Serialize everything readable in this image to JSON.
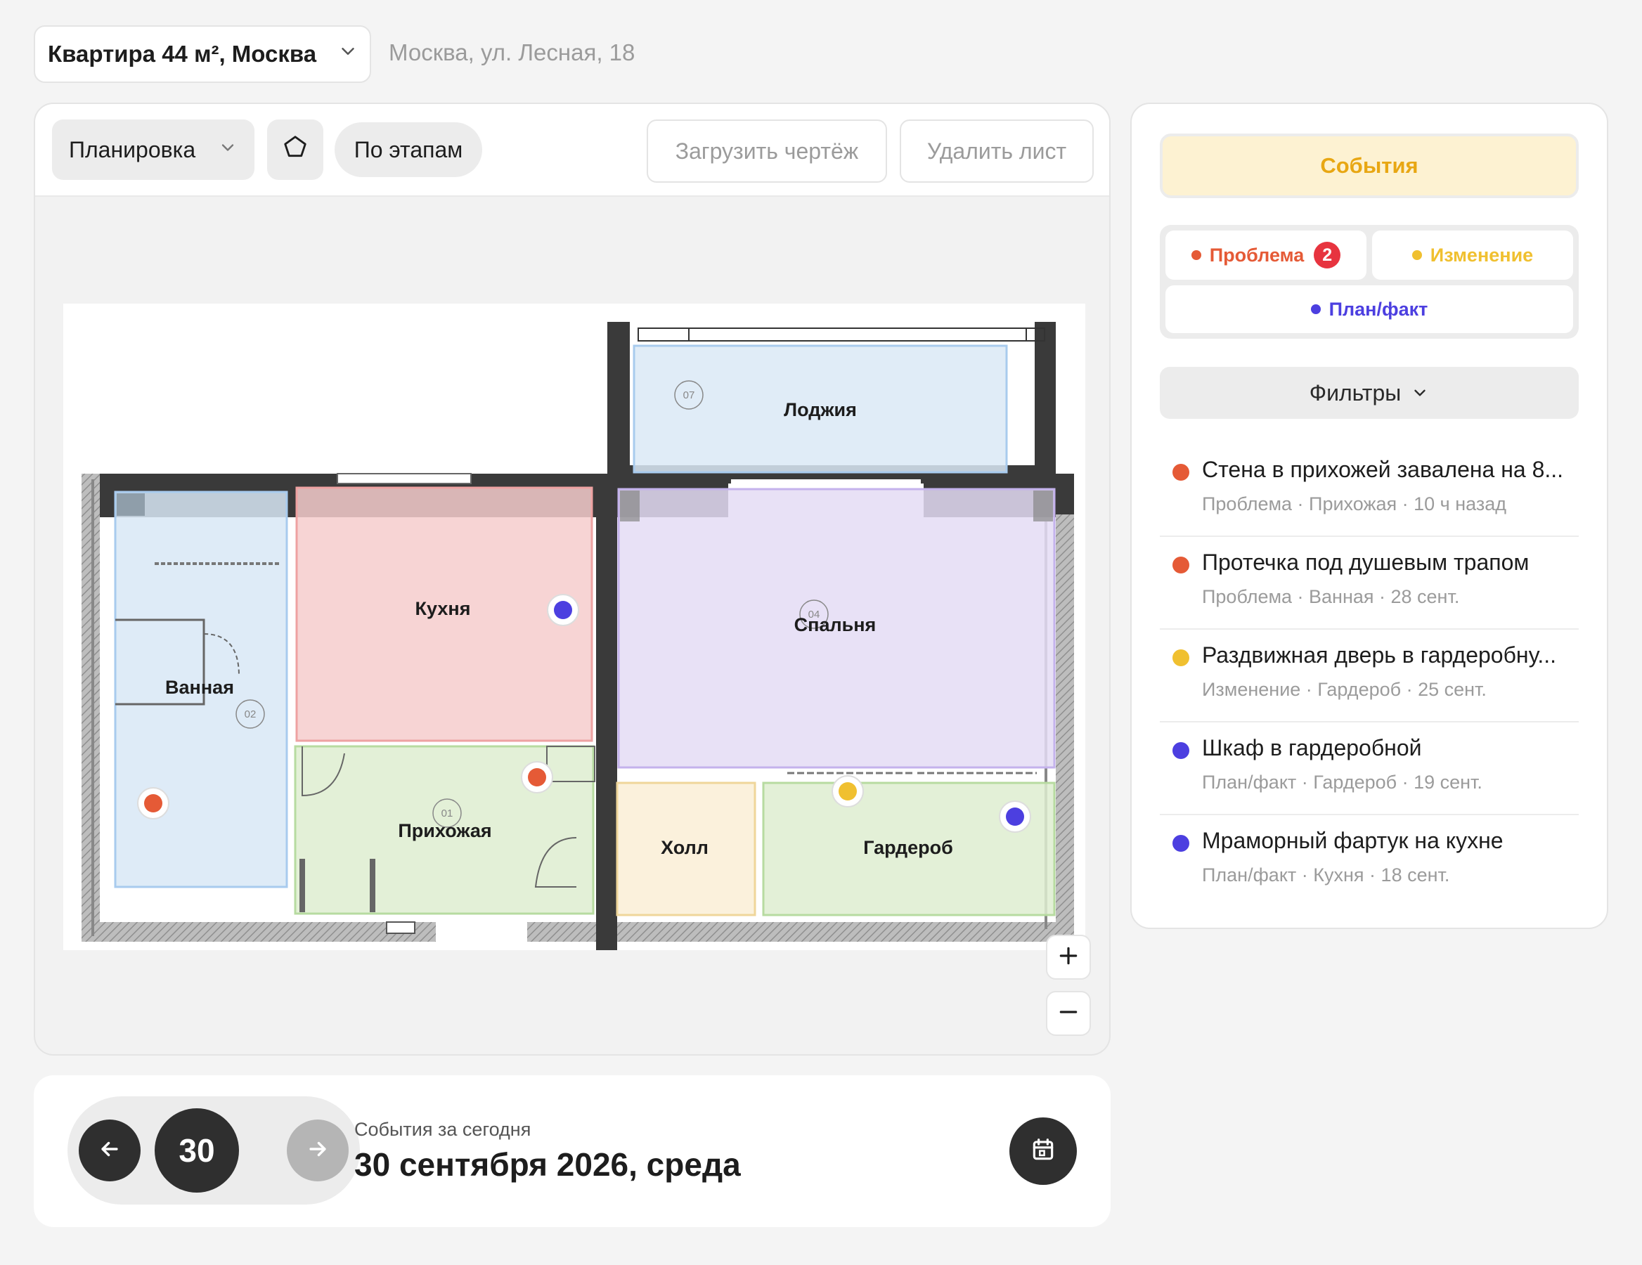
{
  "project": {
    "name": "Квартира 44 м², Москва",
    "address": "Москва, ул. Лесная, 18"
  },
  "toolbar": {
    "layout_label": "Планировка",
    "stages_label": "По этапам",
    "upload_label": "Загрузить чертёж",
    "delete_label": "Удалить лист"
  },
  "rooms": {
    "loggia": {
      "name": "Лоджия",
      "num": "07"
    },
    "kitchen": {
      "name": "Кухня"
    },
    "bedroom": {
      "name": "Спальня",
      "num": "04"
    },
    "bathroom": {
      "name": "Ванная",
      "num": "02"
    },
    "hallway": {
      "name": "Прихожая",
      "num": "01"
    },
    "hall": {
      "name": "Холл"
    },
    "wardrobe": {
      "name": "Гардероб"
    }
  },
  "events_panel": {
    "tab_label": "События",
    "types": {
      "problem": {
        "label": "Проблема",
        "count": "2",
        "color": "#e55a36"
      },
      "change": {
        "label": "Изменение",
        "color": "#f0c030"
      },
      "planfact": {
        "label": "План/факт",
        "color": "#4c3fe0"
      }
    },
    "filters_label": "Фильтры",
    "items": [
      {
        "title": "Стена в прихожей завалена на 8...",
        "meta": "Проблема · Прихожая · 10 ч назад",
        "color": "#e55a36"
      },
      {
        "title": "Протечка под душевым трапом",
        "meta": "Проблема · Ванная · 28 сент.",
        "color": "#e55a36"
      },
      {
        "title": "Раздвижная дверь в гардеробну...",
        "meta": "Изменение · Гардероб · 25 сент.",
        "color": "#f0c030"
      },
      {
        "title": "Шкаф в гардеробной",
        "meta": "План/факт · Гардероб · 19 сент.",
        "color": "#4c3fe0"
      },
      {
        "title": "Мраморный фартук на кухне",
        "meta": "План/факт · Кухня · 18 сент.",
        "color": "#4c3fe0"
      }
    ]
  },
  "date_bar": {
    "day": "30",
    "caption": "События за сегодня",
    "date": "30 сентября 2026, среда"
  },
  "icons": {
    "project_chevron": "chevron-down-icon",
    "polygon": "pentagon-icon",
    "zoom_in": "plus-icon",
    "zoom_out": "minus-icon",
    "prev": "arrow-left-icon",
    "next": "arrow-right-icon",
    "calendar": "calendar-icon"
  }
}
